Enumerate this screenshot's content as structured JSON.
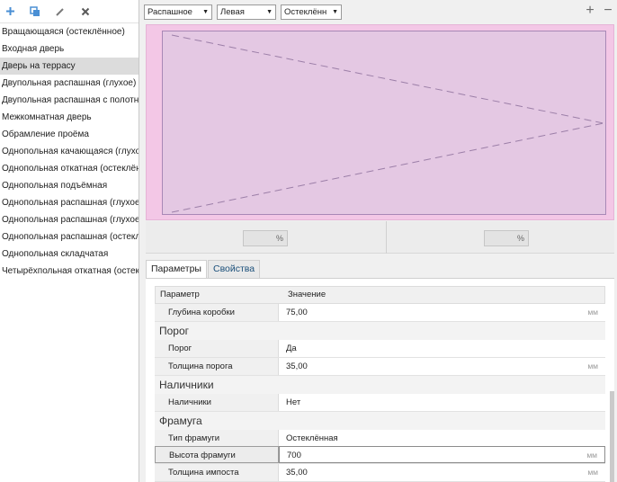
{
  "left_toolbar": {
    "icons": [
      "add-icon",
      "copy-icon",
      "edit-icon",
      "delete-icon"
    ]
  },
  "type_list": [
    "Вращающаяся (остеклённое)",
    "Входная дверь",
    "Дверь на террасу",
    "Двупольная распашная (глухое)",
    "Двупольная распашная с полотна",
    "Межкомнатная дверь",
    "Обрамление проёма",
    "Однопольная качающаяся (глухое",
    "Однопольная откатная (остеклённ",
    "Однопольная подъёмная",
    "Однопольная распашная (глухое с",
    "Однопольная распашная (глухое т",
    "Однопольная распашная (остеклё",
    "Однопольная складчатая",
    "Четырёхпольная откатная (остекл"
  ],
  "selected_index": 2,
  "top_bar": {
    "opening_type": "Распашное",
    "side": "Левая",
    "fill": "Остеклённ",
    "plus": "+",
    "minus": "−"
  },
  "preview": {
    "frame_color": "#f3c7e6",
    "panel_color": "#e4c8e3"
  },
  "pct": {
    "left_unit": "%",
    "right_unit": "%"
  },
  "tabs": {
    "params": "Параметры",
    "props": "Свойства"
  },
  "grid": {
    "col_param": "Параметр",
    "col_value": "Значение",
    "rows": {
      "box_depth": {
        "name": "Глубина коробки",
        "value": "75,00",
        "unit": "мм"
      },
      "threshold_group": "Порог",
      "threshold": {
        "name": "Порог",
        "value": "Да"
      },
      "threshold_thickness": {
        "name": "Толщина порога",
        "value": "35,00",
        "unit": "мм"
      },
      "trim_group": "Наличники",
      "trim": {
        "name": "Наличники",
        "value": "Нет"
      },
      "transom_group": "Фрамуга",
      "transom_type": {
        "name": "Тип фрамуги",
        "value": "Остеклённая"
      },
      "transom_height": {
        "name": "Высота фрамуги",
        "value": "700",
        "unit": "мм"
      },
      "mullion_thickness": {
        "name": "Толщина импоста",
        "value": "35,00",
        "unit": "мм"
      }
    }
  }
}
